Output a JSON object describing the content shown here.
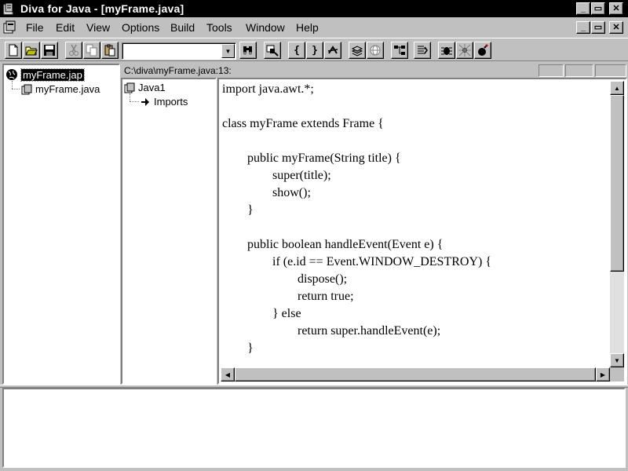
{
  "window": {
    "title": "Diva for Java - [myFrame.java]",
    "caption_buttons": [
      "_",
      "▭",
      "✕"
    ]
  },
  "menu": {
    "items": [
      "File",
      "Edit",
      "View",
      "Options",
      "Build",
      "Tools",
      "Window",
      "Help"
    ],
    "mdi_buttons": [
      "_",
      "▭",
      "✕"
    ]
  },
  "toolbar": {
    "buttons": [
      "new-file",
      "open-folder",
      "save",
      "cut",
      "copy",
      "paste",
      "binoculars",
      "find-replace",
      "open-brace",
      "close-brace",
      "match-brace",
      "compile-stack",
      "web-globe",
      "class-tree",
      "debug-step",
      "run-bug",
      "debug-spider",
      "bomb"
    ],
    "brace_open": "{",
    "brace_close": "}",
    "combo_value": ""
  },
  "project_tree": {
    "root": "myFrame.jap",
    "child": "myFrame.java"
  },
  "class_tree": {
    "root": "Java1",
    "child": "Imports"
  },
  "editor": {
    "path": "C:\\diva\\myFrame.java:13:",
    "lines": [
      "import java.awt.*;",
      "",
      "class myFrame extends Frame {",
      "",
      "        public myFrame(String title) {",
      "                super(title);",
      "                show();",
      "        }",
      "",
      "        public boolean handleEvent(Event e) {",
      "                if (e.id == Event.WINDOW_DESTROY) {",
      "                        dispose();",
      "                        return true;",
      "                } else",
      "                        return super.handleEvent(e);",
      "        }"
    ]
  },
  "output": {
    "text": ""
  }
}
